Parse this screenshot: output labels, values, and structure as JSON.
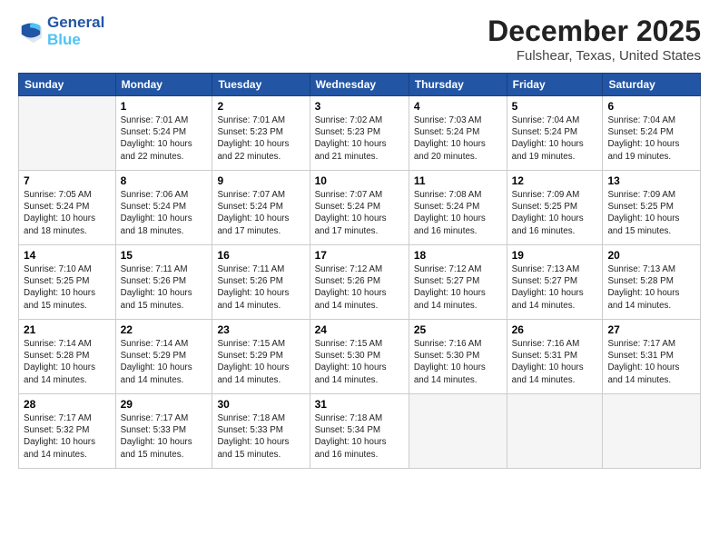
{
  "header": {
    "logo_line1": "General",
    "logo_line2": "Blue",
    "month_title": "December 2025",
    "location": "Fulshear, Texas, United States"
  },
  "weekdays": [
    "Sunday",
    "Monday",
    "Tuesday",
    "Wednesday",
    "Thursday",
    "Friday",
    "Saturday"
  ],
  "weeks": [
    [
      {
        "day": "",
        "info": ""
      },
      {
        "day": "1",
        "info": "Sunrise: 7:01 AM\nSunset: 5:24 PM\nDaylight: 10 hours\nand 22 minutes."
      },
      {
        "day": "2",
        "info": "Sunrise: 7:01 AM\nSunset: 5:23 PM\nDaylight: 10 hours\nand 22 minutes."
      },
      {
        "day": "3",
        "info": "Sunrise: 7:02 AM\nSunset: 5:23 PM\nDaylight: 10 hours\nand 21 minutes."
      },
      {
        "day": "4",
        "info": "Sunrise: 7:03 AM\nSunset: 5:24 PM\nDaylight: 10 hours\nand 20 minutes."
      },
      {
        "day": "5",
        "info": "Sunrise: 7:04 AM\nSunset: 5:24 PM\nDaylight: 10 hours\nand 19 minutes."
      },
      {
        "day": "6",
        "info": "Sunrise: 7:04 AM\nSunset: 5:24 PM\nDaylight: 10 hours\nand 19 minutes."
      }
    ],
    [
      {
        "day": "7",
        "info": "Sunrise: 7:05 AM\nSunset: 5:24 PM\nDaylight: 10 hours\nand 18 minutes."
      },
      {
        "day": "8",
        "info": "Sunrise: 7:06 AM\nSunset: 5:24 PM\nDaylight: 10 hours\nand 18 minutes."
      },
      {
        "day": "9",
        "info": "Sunrise: 7:07 AM\nSunset: 5:24 PM\nDaylight: 10 hours\nand 17 minutes."
      },
      {
        "day": "10",
        "info": "Sunrise: 7:07 AM\nSunset: 5:24 PM\nDaylight: 10 hours\nand 17 minutes."
      },
      {
        "day": "11",
        "info": "Sunrise: 7:08 AM\nSunset: 5:24 PM\nDaylight: 10 hours\nand 16 minutes."
      },
      {
        "day": "12",
        "info": "Sunrise: 7:09 AM\nSunset: 5:25 PM\nDaylight: 10 hours\nand 16 minutes."
      },
      {
        "day": "13",
        "info": "Sunrise: 7:09 AM\nSunset: 5:25 PM\nDaylight: 10 hours\nand 15 minutes."
      }
    ],
    [
      {
        "day": "14",
        "info": "Sunrise: 7:10 AM\nSunset: 5:25 PM\nDaylight: 10 hours\nand 15 minutes."
      },
      {
        "day": "15",
        "info": "Sunrise: 7:11 AM\nSunset: 5:26 PM\nDaylight: 10 hours\nand 15 minutes."
      },
      {
        "day": "16",
        "info": "Sunrise: 7:11 AM\nSunset: 5:26 PM\nDaylight: 10 hours\nand 14 minutes."
      },
      {
        "day": "17",
        "info": "Sunrise: 7:12 AM\nSunset: 5:26 PM\nDaylight: 10 hours\nand 14 minutes."
      },
      {
        "day": "18",
        "info": "Sunrise: 7:12 AM\nSunset: 5:27 PM\nDaylight: 10 hours\nand 14 minutes."
      },
      {
        "day": "19",
        "info": "Sunrise: 7:13 AM\nSunset: 5:27 PM\nDaylight: 10 hours\nand 14 minutes."
      },
      {
        "day": "20",
        "info": "Sunrise: 7:13 AM\nSunset: 5:28 PM\nDaylight: 10 hours\nand 14 minutes."
      }
    ],
    [
      {
        "day": "21",
        "info": "Sunrise: 7:14 AM\nSunset: 5:28 PM\nDaylight: 10 hours\nand 14 minutes."
      },
      {
        "day": "22",
        "info": "Sunrise: 7:14 AM\nSunset: 5:29 PM\nDaylight: 10 hours\nand 14 minutes."
      },
      {
        "day": "23",
        "info": "Sunrise: 7:15 AM\nSunset: 5:29 PM\nDaylight: 10 hours\nand 14 minutes."
      },
      {
        "day": "24",
        "info": "Sunrise: 7:15 AM\nSunset: 5:30 PM\nDaylight: 10 hours\nand 14 minutes."
      },
      {
        "day": "25",
        "info": "Sunrise: 7:16 AM\nSunset: 5:30 PM\nDaylight: 10 hours\nand 14 minutes."
      },
      {
        "day": "26",
        "info": "Sunrise: 7:16 AM\nSunset: 5:31 PM\nDaylight: 10 hours\nand 14 minutes."
      },
      {
        "day": "27",
        "info": "Sunrise: 7:17 AM\nSunset: 5:31 PM\nDaylight: 10 hours\nand 14 minutes."
      }
    ],
    [
      {
        "day": "28",
        "info": "Sunrise: 7:17 AM\nSunset: 5:32 PM\nDaylight: 10 hours\nand 14 minutes."
      },
      {
        "day": "29",
        "info": "Sunrise: 7:17 AM\nSunset: 5:33 PM\nDaylight: 10 hours\nand 15 minutes."
      },
      {
        "day": "30",
        "info": "Sunrise: 7:18 AM\nSunset: 5:33 PM\nDaylight: 10 hours\nand 15 minutes."
      },
      {
        "day": "31",
        "info": "Sunrise: 7:18 AM\nSunset: 5:34 PM\nDaylight: 10 hours\nand 16 minutes."
      },
      {
        "day": "",
        "info": ""
      },
      {
        "day": "",
        "info": ""
      },
      {
        "day": "",
        "info": ""
      }
    ]
  ]
}
